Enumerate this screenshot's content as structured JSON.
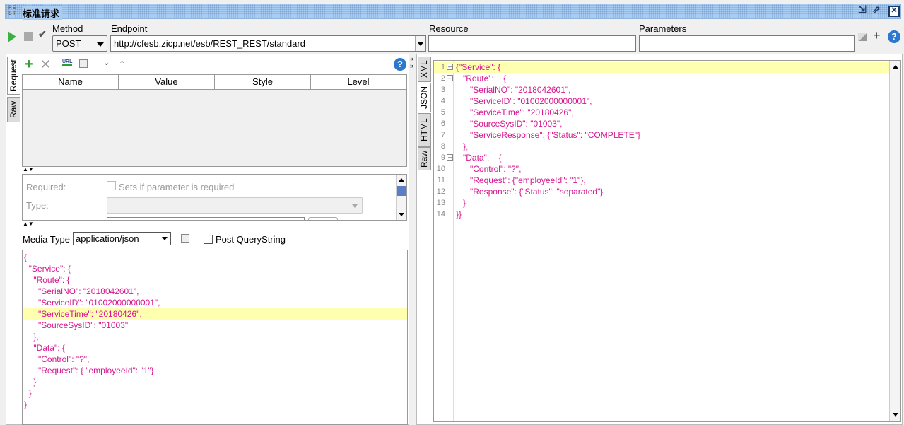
{
  "window": {
    "logo": "RE ST",
    "title": "标准请求"
  },
  "toolbar": {
    "method_label": "Method",
    "method_value": "POST",
    "endpoint_label": "Endpoint",
    "endpoint_value": "http://cfesb.zicp.net/esb/REST_REST/standard",
    "resource_label": "Resource",
    "resource_value": "",
    "parameters_label": "Parameters",
    "parameters_value": ""
  },
  "request": {
    "tabs": [
      "Request",
      "Raw"
    ],
    "columns": [
      "Name",
      "Value",
      "Style",
      "Level"
    ],
    "required_label": "Required:",
    "required_checkbox_label": "Sets if parameter is required",
    "required_checked": false,
    "type_label": "Type:",
    "type_value": "",
    "media_type_label": "Media Type",
    "media_type_value": "application/json",
    "post_querystring_label": "Post QueryString",
    "post_querystring_checked": false,
    "body_lines": [
      "{",
      "  \"Service\": {",
      "    \"Route\": {",
      "      \"SerialNO\": \"2018042601\",",
      "      \"ServiceID\": \"01002000000001\",",
      "      \"ServiceTime\": \"20180426\",",
      "      \"SourceSysID\": \"01003\"",
      "    },",
      "    \"Data\": {",
      "      \"Control\": \"?\",",
      "      \"Request\": { \"employeeId\": \"1\"}",
      "    }",
      "  }",
      "}"
    ],
    "highlighted_line": 6
  },
  "response": {
    "tabs": [
      "XML",
      "JSON",
      "HTML",
      "Raw"
    ],
    "active_tab": "JSON",
    "line_numbers": [
      "1",
      "2",
      "3",
      "4",
      "5",
      "6",
      "7",
      "8",
      "9",
      "10",
      "11",
      "12",
      "13",
      "14"
    ],
    "foldable_lines": [
      1,
      2,
      9
    ],
    "lines": [
      "{\"Service\": {",
      "   \"Route\":    {",
      "      \"SerialNO\": \"2018042601\",",
      "      \"ServiceID\": \"01002000000001\",",
      "      \"ServiceTime\": \"20180426\",",
      "      \"SourceSysID\": \"01003\",",
      "      \"ServiceResponse\": {\"Status\": \"COMPLETE\"}",
      "   },",
      "   \"Data\":    {",
      "      \"Control\": \"?\",",
      "      \"Request\": {\"employeeId\": \"1\"},",
      "      \"Response\": {\"Status\": \"separated\"}",
      "   }",
      "}}"
    ],
    "highlighted_line": 1
  },
  "colors": {
    "highlight": "#ffffb0",
    "brace": "#ff2200",
    "string": "#d8158f",
    "titlebar": "#a9cdf2",
    "run": "#3cb043"
  }
}
